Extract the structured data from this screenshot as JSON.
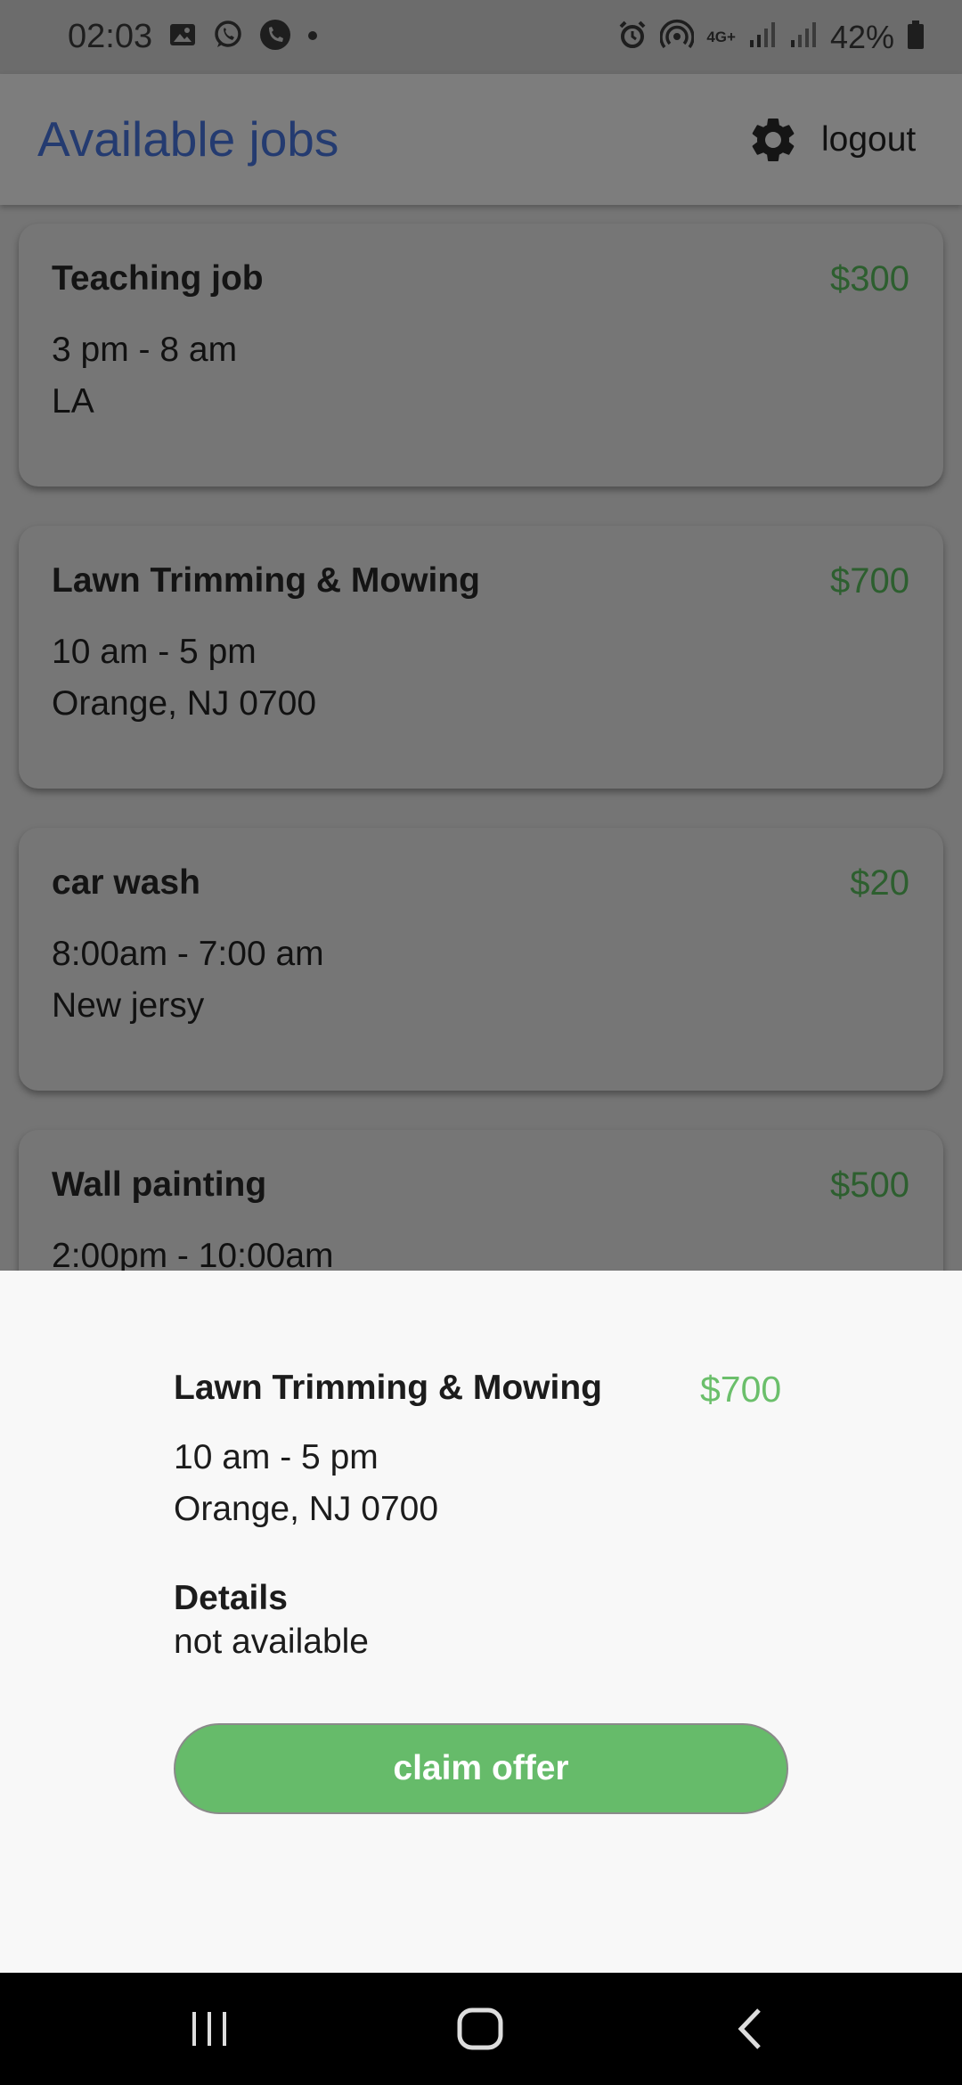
{
  "status_bar": {
    "time": "02:03",
    "network": "4G+",
    "battery": "42%",
    "icons": [
      "image-icon",
      "whatsapp-icon",
      "phone-icon",
      "alarm-icon",
      "hotspot-icon",
      "signal-icon",
      "battery-icon"
    ]
  },
  "header": {
    "title": "Available jobs",
    "settings_icon": "gear-icon",
    "logout_label": "logout"
  },
  "jobs": [
    {
      "title": "Teaching job",
      "price": "$300",
      "time": "3 pm  - 8 am",
      "location": "LA"
    },
    {
      "title": "Lawn Trimming & Mowing",
      "price": "$700",
      "time": "10 am  - 5 pm",
      "location": "Orange, NJ 0700"
    },
    {
      "title": "car wash",
      "price": "$20",
      "time": "8:00am  - 7:00 am",
      "location": "New jersy"
    },
    {
      "title": "Wall painting",
      "price": "$500",
      "time": "2:00pm  - 10:00am",
      "location": ""
    }
  ],
  "detail_sheet": {
    "title": "Lawn Trimming & Mowing",
    "price": "$700",
    "time": "10 am  - 5 pm",
    "location": "Orange, NJ 0700",
    "details_label": "Details",
    "details_value": "not available",
    "claim_label": "claim offer"
  },
  "colors": {
    "accent_green": "#66bb6a",
    "title_blue": "#243b70"
  },
  "nav_bar": {
    "icons": [
      "recent-apps-icon",
      "home-icon",
      "back-icon"
    ]
  }
}
